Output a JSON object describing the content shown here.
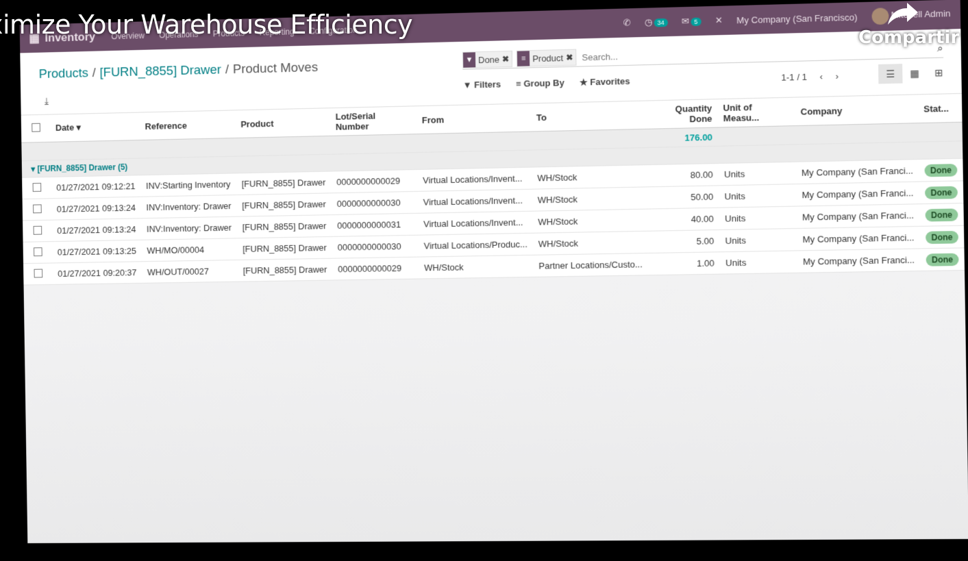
{
  "overlay": {
    "video_title": "ximize Your Warehouse Efficiency",
    "share_label": "Compartir"
  },
  "navbar": {
    "app_name": "Inventory",
    "menu": [
      "Overview",
      "Operations",
      "Products",
      "Reporting",
      "Configuration"
    ],
    "activity_count": "34",
    "messages_count": "5",
    "company": "My Company (San Francisco)",
    "user": "Mitchell Admin"
  },
  "breadcrumb": {
    "products": "Products",
    "product": "[FURN_8855] Drawer",
    "current": "Product Moves"
  },
  "search": {
    "facets": [
      {
        "icon": "filter-icon",
        "label": "Done"
      },
      {
        "icon": "groupby-icon",
        "label": "Product"
      }
    ],
    "placeholder": "Search..."
  },
  "toolbar": {
    "filters": "Filters",
    "group_by": "Group By",
    "favorites": "Favorites",
    "pager": "1-1 / 1"
  },
  "table": {
    "columns": [
      "Date",
      "Reference",
      "Product",
      "Lot/Serial Number",
      "From",
      "To",
      "Quantity Done",
      "Unit of Measu...",
      "Company",
      "Stat..."
    ],
    "total_quantity": "176.00",
    "group_label": "[FURN_8855] Drawer (5)",
    "rows": [
      {
        "date": "01/27/2021 09:12:21",
        "reference": "INV:Starting Inventory",
        "product": "[FURN_8855] Drawer",
        "lot": "0000000000029",
        "from": "Virtual Locations/Invent...",
        "to": "WH/Stock",
        "qty": "80.00",
        "uom": "Units",
        "company": "My Company (San Franci...",
        "status": "Done"
      },
      {
        "date": "01/27/2021 09:13:24",
        "reference": "INV:Inventory: Drawer",
        "product": "[FURN_8855] Drawer",
        "lot": "0000000000030",
        "from": "Virtual Locations/Invent...",
        "to": "WH/Stock",
        "qty": "50.00",
        "uom": "Units",
        "company": "My Company (San Franci...",
        "status": "Done"
      },
      {
        "date": "01/27/2021 09:13:24",
        "reference": "INV:Inventory: Drawer",
        "product": "[FURN_8855] Drawer",
        "lot": "0000000000031",
        "from": "Virtual Locations/Invent...",
        "to": "WH/Stock",
        "qty": "40.00",
        "uom": "Units",
        "company": "My Company (San Franci...",
        "status": "Done"
      },
      {
        "date": "01/27/2021 09:13:25",
        "reference": "WH/MO/00004",
        "product": "[FURN_8855] Drawer",
        "lot": "0000000000030",
        "from": "Virtual Locations/Produc...",
        "to": "WH/Stock",
        "qty": "5.00",
        "uom": "Units",
        "company": "My Company (San Franci...",
        "status": "Done"
      },
      {
        "date": "01/27/2021 09:20:37",
        "reference": "WH/OUT/00027",
        "product": "[FURN_8855] Drawer",
        "lot": "0000000000029",
        "from": "WH/Stock",
        "to": "Partner Locations/Custo...",
        "qty": "1.00",
        "uom": "Units",
        "company": "My Company (San Franci...",
        "status": "Done"
      }
    ]
  },
  "colors": {
    "navbar": "#6b4d68",
    "accent": "#017e84",
    "total": "#00a09d",
    "done_badge": "#8fc99a"
  }
}
